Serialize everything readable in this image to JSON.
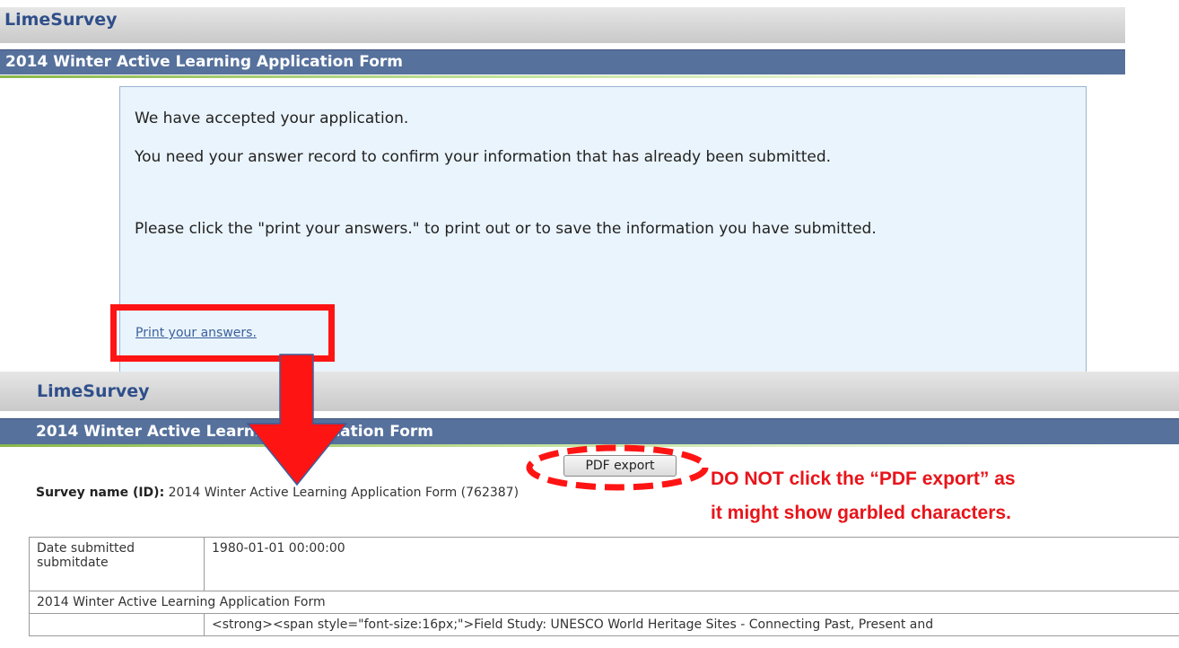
{
  "top_view": {
    "brand": "LimeSurvey",
    "form_title": "2014 Winter Active Learning Application Form",
    "messages": [
      "We have accepted your application.",
      "You need your answer record to confirm your information that has already been submitted.",
      "Please click the \"print your answers.\" to print out or to save the information you have submitted."
    ],
    "print_link_label": "Print your answers."
  },
  "bottom_view": {
    "brand": "LimeSurvey",
    "form_title": "2014 Winter Active Learning Application Form",
    "pdf_export_label": "PDF export",
    "survey_name_label": "Survey name (ID):",
    "survey_name_value": "2014 Winter Active Learning Application Form (762387)",
    "table": {
      "rows": [
        {
          "label": "Date submitted submitdate",
          "value": "1980-01-01 00:00:00"
        },
        {
          "group_title": "2014 Winter Active Learning Application Form"
        },
        {
          "label": "",
          "value": "<strong><span style=\"font-size:16px;\">Field Study:  UNESCO World Heritage Sites - Connecting Past, Present and"
        }
      ]
    }
  },
  "annotations": {
    "warning_line_1": "DO NOT click the “PDF export” as",
    "warning_line_2": "it might show garbled characters.",
    "highlight_color": "#ff1414",
    "warning_color": "#e8141a"
  }
}
